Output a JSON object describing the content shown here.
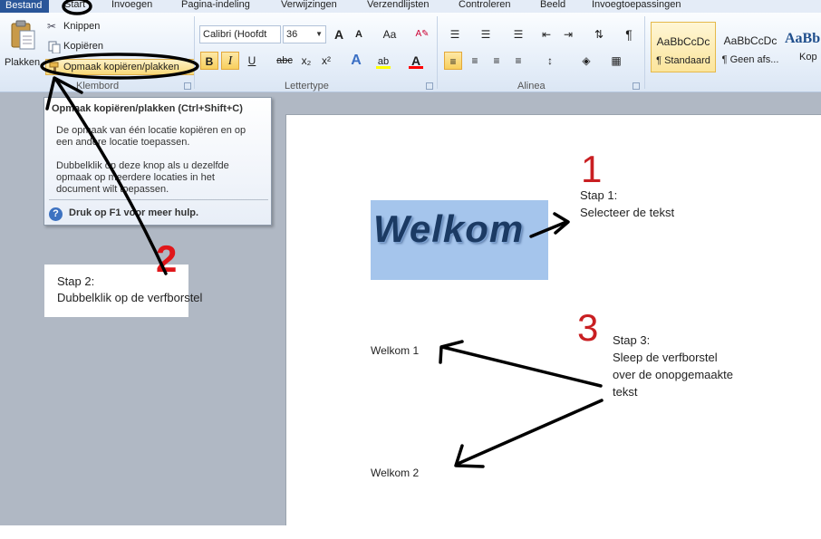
{
  "tabs": {
    "file": "Bestand",
    "items": [
      "Start",
      "Invoegen",
      "Pagina-indeling",
      "Verwijzingen",
      "Verzendlijsten",
      "Controleren",
      "Beeld",
      "Invoegtoepassingen"
    ]
  },
  "clipboard": {
    "paste_label": "Plakken",
    "cut_label": "Knippen",
    "copy_label": "Kopiëren",
    "format_painter_label": "Opmaak kopiëren/plakken",
    "group_label": "Klembord"
  },
  "font": {
    "family": "Calibri (Hoofdt",
    "size": "36",
    "grow": "A",
    "shrink": "A",
    "case": "Aa",
    "bold": "B",
    "italic": "I",
    "underline": "U",
    "strike": "abc",
    "subscript": "x₂",
    "superscript": "x²",
    "highlight_color": "#ffff00",
    "font_color": "#ff0000",
    "group_label": "Lettertype"
  },
  "paragraph": {
    "pilcrow": "¶",
    "group_label": "Alinea"
  },
  "styles": {
    "items": [
      {
        "sample": "AaBbCcDc",
        "name": "¶ Standaard"
      },
      {
        "sample": "AaBbCcDc",
        "name": "¶ Geen afs..."
      },
      {
        "sample": "AaBb",
        "name": "Kop"
      }
    ]
  },
  "tooltip": {
    "title": "Opmaak kopiëren/plakken (Ctrl+Shift+C)",
    "lines": [
      "De opmaak van één locatie kopiëren en op",
      "een andere locatie toepassen.",
      "",
      "Dubbelklik op deze knop als u dezelfde",
      "opmaak op meerdere locaties in het",
      "document wilt toepassen."
    ],
    "help": "Druk op F1 voor meer hulp."
  },
  "document": {
    "heading": "Welkom",
    "line1": "Welkom 1",
    "line2": "Welkom 2"
  },
  "annotations": {
    "num1": "1",
    "num2": "2",
    "num3": "3",
    "stap1": [
      "Stap 1:",
      "Selecteer de tekst"
    ],
    "stap2": [
      "Stap 2:",
      "Dubbelklik op de verfborstel"
    ],
    "stap3": [
      "Stap 3:",
      "Sleep de verfborstel",
      "over de onopgemaakte",
      "tekst"
    ]
  }
}
